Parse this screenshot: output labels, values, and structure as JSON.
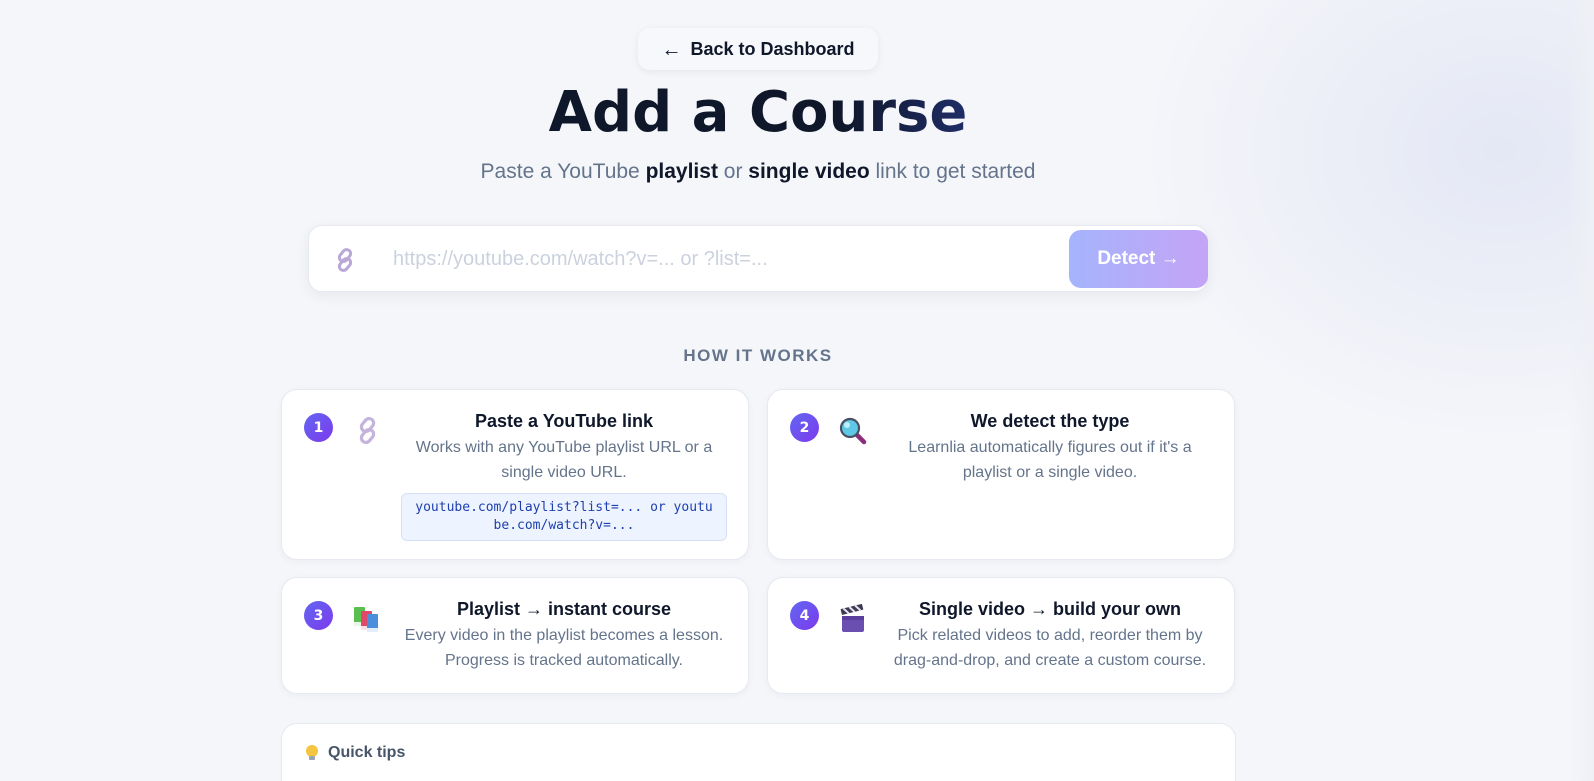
{
  "nav": {
    "back_arrow": "←",
    "back_label": "Back to Dashboard"
  },
  "header": {
    "title": "Add a Course",
    "subtitle_pre": "Paste a YouTube ",
    "subtitle_bold1": "playlist",
    "subtitle_mid": " or ",
    "subtitle_bold2": "single video",
    "subtitle_post": " link to get started"
  },
  "search": {
    "icon": "link-icon",
    "placeholder": "https://youtube.com/watch?v=... or ?list=...",
    "value": "",
    "button_label": "Detect →"
  },
  "how_it_works": {
    "label": "HOW IT WORKS",
    "steps": [
      {
        "number": "1",
        "icon": "link-icon",
        "title": "Paste a YouTube link",
        "desc": "Works with any YouTube playlist URL or a single video URL.",
        "code": "youtube.com/playlist?list=... or youtube.com/watch?v=..."
      },
      {
        "number": "2",
        "icon": "magnifier-icon",
        "title": "We detect the type",
        "desc": "Learnlia automatically figures out if it's a playlist or a single video."
      },
      {
        "number": "3",
        "icon": "books-icon",
        "title": "Playlist → instant course",
        "desc": "Every video in the playlist becomes a lesson. Progress is tracked automatically."
      },
      {
        "number": "4",
        "icon": "clapperboard-icon",
        "title": "Single video → build your own",
        "desc": "Pick related videos to add, reorder them by drag-and-drop, and create a custom course."
      }
    ]
  },
  "tips": {
    "icon": "lightbulb-icon",
    "title": "Quick tips"
  },
  "colors": {
    "accent_start": "#6366f1",
    "accent_end": "#7c3aed",
    "button_start": "#a5b4fc",
    "button_end": "#c4a4f5",
    "background": "#f5f6fa",
    "heading": "#0f172a",
    "muted": "#64748b"
  }
}
